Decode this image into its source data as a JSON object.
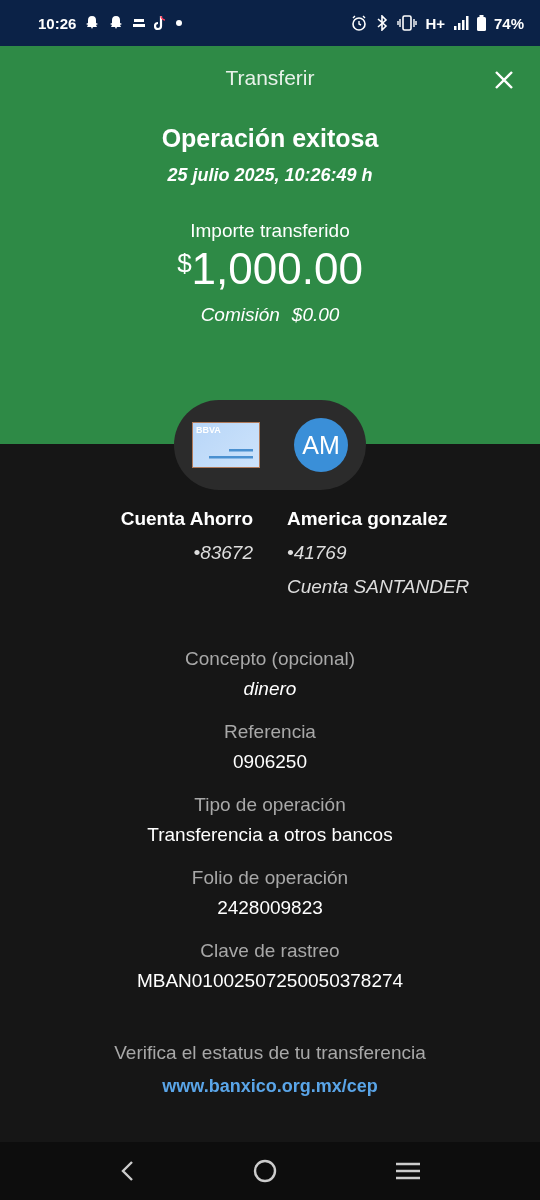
{
  "status_bar": {
    "time": "10:26",
    "network": "H+",
    "battery": "74%"
  },
  "header": {
    "title": "Transferir"
  },
  "result": {
    "title": "Operación exitosa",
    "datetime": "25 julio 2025, 10:26:49 h",
    "amount_label": "Importe transferido",
    "currency": "$",
    "amount": "1,000.00",
    "fee_label": "Comisión",
    "fee": "$0.00"
  },
  "accounts": {
    "card_brand": "BBVA",
    "recipient_initials": "AM",
    "from": {
      "name": "Cuenta Ahorro",
      "number": "•83672"
    },
    "to": {
      "name": "America gonzalez",
      "number": "•41769",
      "bank": "Cuenta SANTANDER"
    }
  },
  "details": [
    {
      "label": "Concepto (opcional)",
      "value": "dinero",
      "italic": true
    },
    {
      "label": "Referencia",
      "value": "0906250",
      "italic": false
    },
    {
      "label": "Tipo de operación",
      "value": "Transferencia a otros bancos",
      "italic": false
    },
    {
      "label": "Folio de operación",
      "value": "2428009823",
      "italic": false
    },
    {
      "label": "Clave de rastreo",
      "value": "MBAN01002507250050378274",
      "italic": false
    }
  ],
  "footer": {
    "text": "Verifica el estatus de tu transferencia",
    "link": "www.banxico.org.mx/cep"
  }
}
